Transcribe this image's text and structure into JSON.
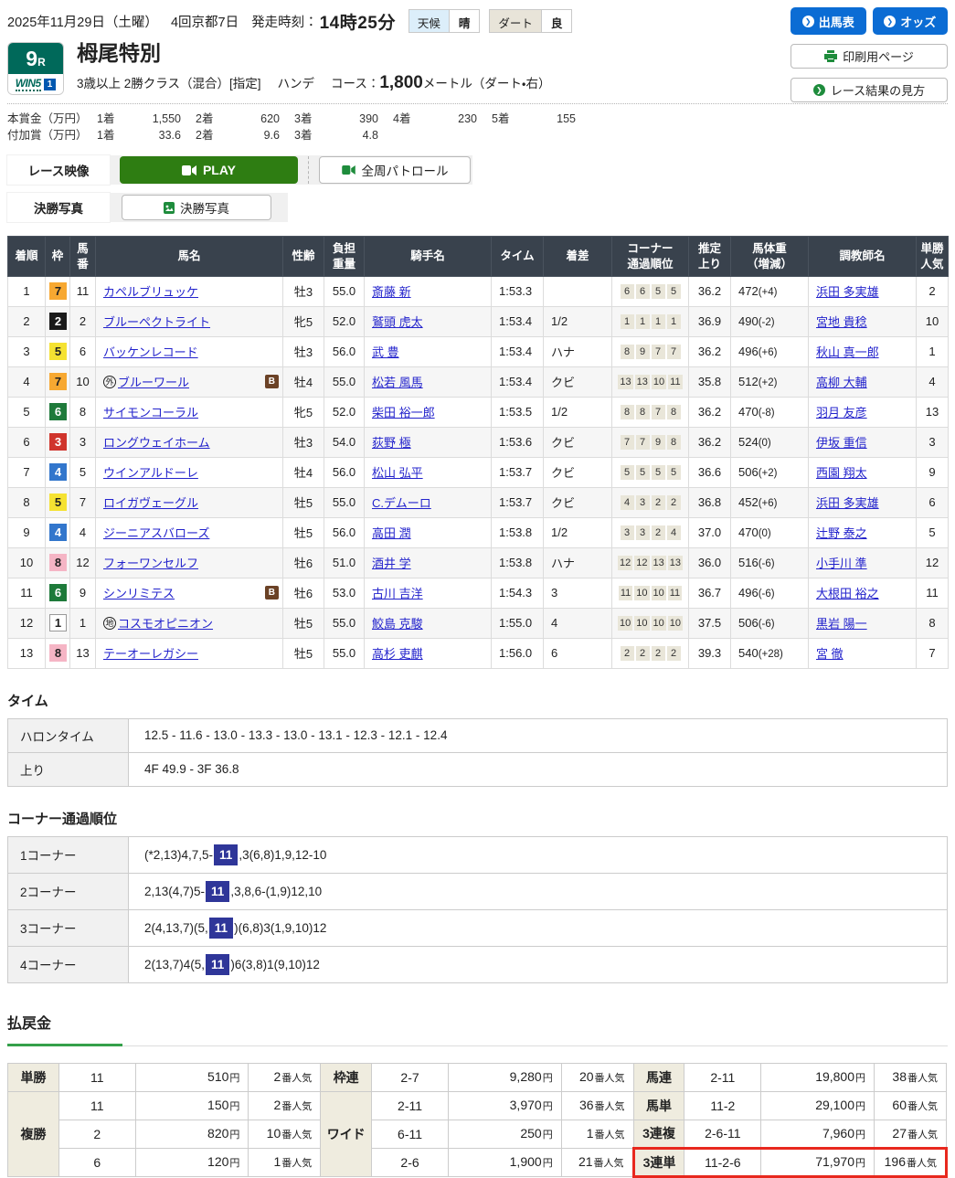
{
  "topbar": {
    "date": "2025年11月29日（土曜）",
    "meeting": "4回京都7日",
    "start_label": "発走時刻：",
    "start_time": "14時25分",
    "weather": {
      "label": "天候",
      "value": "晴"
    },
    "track": {
      "label": "ダート",
      "value": "良"
    }
  },
  "actions": {
    "entries": "出馬表",
    "odds": "オッズ",
    "print": "印刷用ページ",
    "guide": "レース結果の見方"
  },
  "race": {
    "number": "9",
    "r_suffix": "R",
    "win5": "WIN5",
    "win5_num": "1",
    "title": "栂尾特別",
    "cond": "3歳以上 2勝クラス（混合）[指定]",
    "handicap": "ハンデ",
    "course_label": "コース：",
    "distance": "1,800",
    "course_suffix": "メートル（ダート・右）"
  },
  "prizes": {
    "main": {
      "label": "本賞金（万円）",
      "items": [
        {
          "pos": "1着",
          "val": "1,550"
        },
        {
          "pos": "2着",
          "val": "620"
        },
        {
          "pos": "3着",
          "val": "390"
        },
        {
          "pos": "4着",
          "val": "230"
        },
        {
          "pos": "5着",
          "val": "155"
        }
      ]
    },
    "add": {
      "label": "付加賞（万円）",
      "items": [
        {
          "pos": "1着",
          "val": "33.6"
        },
        {
          "pos": "2着",
          "val": "9.6"
        },
        {
          "pos": "3着",
          "val": "4.8"
        }
      ]
    }
  },
  "media": {
    "video_label": "レース映像",
    "play": "PLAY",
    "patrol": "全周パトロール",
    "photo_label": "決勝写真",
    "photo_btn": "決勝写真"
  },
  "results": {
    "headers": [
      "着順",
      "枠",
      "馬\n番",
      "馬名",
      "性齢",
      "負担\n重量",
      "騎手名",
      "タイム",
      "着差",
      "コーナー\n通過順位",
      "推定\n上り",
      "馬体重\n（増減）",
      "調教師名",
      "単勝\n人気"
    ],
    "rows": [
      {
        "finish": "1",
        "frame": "7",
        "num": "11",
        "name": "カペルブリュッケ",
        "sex_age": "牡3",
        "weight": "55.0",
        "jockey": "斎藤 新",
        "time": "1:53.3",
        "margin": "",
        "corners": [
          "6",
          "6",
          "5",
          "5"
        ],
        "last3f": "36.2",
        "horse_weight": "472",
        "weight_diff": "(+4)",
        "trainer": "浜田 多実雄",
        "fav": "2"
      },
      {
        "finish": "2",
        "frame": "2",
        "num": "2",
        "name": "ブルーペクトライト",
        "sex_age": "牝5",
        "weight": "52.0",
        "jockey": "鷲頭 虎太",
        "time": "1:53.4",
        "margin": "1/2",
        "corners": [
          "1",
          "1",
          "1",
          "1"
        ],
        "last3f": "36.9",
        "horse_weight": "490",
        "weight_diff": "(-2)",
        "trainer": "宮地 貴稔",
        "fav": "10"
      },
      {
        "finish": "3",
        "frame": "5",
        "num": "6",
        "name": "バッケンレコード",
        "sex_age": "牡3",
        "weight": "56.0",
        "jockey": "武 豊",
        "time": "1:53.4",
        "margin": "ハナ",
        "corners": [
          "8",
          "9",
          "7",
          "7"
        ],
        "last3f": "36.2",
        "horse_weight": "496",
        "weight_diff": "(+6)",
        "trainer": "秋山 真一郎",
        "fav": "1"
      },
      {
        "finish": "4",
        "frame": "7",
        "num": "10",
        "mark": "外",
        "name": "ブルーワール",
        "b_badge": "B",
        "sex_age": "牡4",
        "weight": "55.0",
        "jockey": "松若 風馬",
        "time": "1:53.4",
        "margin": "クビ",
        "corners": [
          "13",
          "13",
          "10",
          "11"
        ],
        "last3f": "35.8",
        "horse_weight": "512",
        "weight_diff": "(+2)",
        "trainer": "高柳 大輔",
        "fav": "4"
      },
      {
        "finish": "5",
        "frame": "6",
        "num": "8",
        "name": "サイモンコーラル",
        "sex_age": "牝5",
        "weight": "52.0",
        "jockey": "柴田 裕一郎",
        "time": "1:53.5",
        "margin": "1/2",
        "corners": [
          "8",
          "8",
          "7",
          "8"
        ],
        "last3f": "36.2",
        "horse_weight": "470",
        "weight_diff": "(-8)",
        "trainer": "羽月 友彦",
        "fav": "13"
      },
      {
        "finish": "6",
        "frame": "3",
        "num": "3",
        "name": "ロングウェイホーム",
        "sex_age": "牡3",
        "weight": "54.0",
        "jockey": "荻野 極",
        "time": "1:53.6",
        "margin": "クビ",
        "corners": [
          "7",
          "7",
          "9",
          "8"
        ],
        "last3f": "36.2",
        "horse_weight": "524",
        "weight_diff": "(0)",
        "trainer": "伊坂 重信",
        "fav": "3"
      },
      {
        "finish": "7",
        "frame": "4",
        "num": "5",
        "name": "ウインアルドーレ",
        "sex_age": "牡4",
        "weight": "56.0",
        "jockey": "松山 弘平",
        "time": "1:53.7",
        "margin": "クビ",
        "corners": [
          "5",
          "5",
          "5",
          "5"
        ],
        "last3f": "36.6",
        "horse_weight": "506",
        "weight_diff": "(+2)",
        "trainer": "西園 翔太",
        "fav": "9"
      },
      {
        "finish": "8",
        "frame": "5",
        "num": "7",
        "name": "ロイガヴェーグル",
        "sex_age": "牡5",
        "weight": "55.0",
        "jockey": "C.デムーロ",
        "time": "1:53.7",
        "margin": "クビ",
        "corners": [
          "4",
          "3",
          "2",
          "2"
        ],
        "last3f": "36.8",
        "horse_weight": "452",
        "weight_diff": "(+6)",
        "trainer": "浜田 多実雄",
        "fav": "6"
      },
      {
        "finish": "9",
        "frame": "4",
        "num": "4",
        "name": "ジーニアスバローズ",
        "sex_age": "牡5",
        "weight": "56.0",
        "jockey": "高田 潤",
        "time": "1:53.8",
        "margin": "1/2",
        "corners": [
          "3",
          "3",
          "2",
          "4"
        ],
        "last3f": "37.0",
        "horse_weight": "470",
        "weight_diff": "(0)",
        "trainer": "辻野 泰之",
        "fav": "5"
      },
      {
        "finish": "10",
        "frame": "8",
        "num": "12",
        "name": "フォーワンセルフ",
        "sex_age": "牡6",
        "weight": "51.0",
        "jockey": "酒井 学",
        "time": "1:53.8",
        "margin": "ハナ",
        "corners": [
          "12",
          "12",
          "13",
          "13"
        ],
        "last3f": "36.0",
        "horse_weight": "516",
        "weight_diff": "(-6)",
        "trainer": "小手川 準",
        "fav": "12"
      },
      {
        "finish": "11",
        "frame": "6",
        "num": "9",
        "name": "シンリミテス",
        "b_badge": "B",
        "sex_age": "牡6",
        "weight": "53.0",
        "jockey": "古川 吉洋",
        "time": "1:54.3",
        "margin": "3",
        "corners": [
          "11",
          "10",
          "10",
          "11"
        ],
        "last3f": "36.7",
        "horse_weight": "496",
        "weight_diff": "(-6)",
        "trainer": "大根田 裕之",
        "fav": "11"
      },
      {
        "finish": "12",
        "frame": "1",
        "num": "1",
        "mark": "地",
        "name": "コスモオピニオン",
        "sex_age": "牡5",
        "weight": "55.0",
        "jockey": "鮫島 克駿",
        "time": "1:55.0",
        "margin": "4",
        "corners": [
          "10",
          "10",
          "10",
          "10"
        ],
        "last3f": "37.5",
        "horse_weight": "506",
        "weight_diff": "(-6)",
        "trainer": "黒岩 陽一",
        "fav": "8"
      },
      {
        "finish": "13",
        "frame": "8",
        "num": "13",
        "name": "テーオーレガシー",
        "sex_age": "牡5",
        "weight": "55.0",
        "jockey": "高杉 吏麒",
        "time": "1:56.0",
        "margin": "6",
        "corners": [
          "2",
          "2",
          "2",
          "2"
        ],
        "last3f": "39.3",
        "horse_weight": "540",
        "weight_diff": "(+28)",
        "trainer": "宮 徹",
        "fav": "7"
      }
    ]
  },
  "time": {
    "title": "タイム",
    "rows": [
      {
        "label": "ハロンタイム",
        "value": "12.5 - 11.6 - 13.0 - 13.3 - 13.0 - 13.1 - 12.3 - 12.1 - 12.4"
      },
      {
        "label": "上り",
        "value": "4F 49.9 - 3F 36.8"
      }
    ]
  },
  "corners": {
    "title": "コーナー通過順位",
    "rows": [
      {
        "label": "1コーナー",
        "pre": "(*2,13)4,7,5-",
        "hl": "11",
        "post": ",3(6,8)1,9,12-10"
      },
      {
        "label": "2コーナー",
        "pre": "2,13(4,7)5-",
        "hl": "11",
        "post": ",3,8,6-(1,9)12,10"
      },
      {
        "label": "3コーナー",
        "pre": "2(4,13,7)(5,",
        "hl": "11",
        "post": ")(6,8)3(1,9,10)12"
      },
      {
        "label": "4コーナー",
        "pre": "2(13,7)4(5,",
        "hl": "11",
        "post": ")6(3,8)1(9,10)12"
      }
    ]
  },
  "payouts": {
    "title": "払戻金",
    "unit_yen": "円",
    "unit_fav": "番人気",
    "groups": [
      {
        "rows": [
          {
            "type": "単勝",
            "span": 1,
            "comb": "11",
            "amount": "510",
            "fav": "2"
          },
          {
            "type": "複勝",
            "span": 3,
            "comb": "11",
            "amount": "150",
            "fav": "2"
          },
          {
            "comb": "2",
            "amount": "820",
            "fav": "10",
            "inner": true
          },
          {
            "comb": "6",
            "amount": "120",
            "fav": "1",
            "inner": true
          }
        ]
      },
      {
        "rows": [
          {
            "type": "枠連",
            "span": 1,
            "comb": "2-7",
            "amount": "9,280",
            "fav": "20"
          },
          {
            "type": "ワイド",
            "span": 3,
            "comb": "2-11",
            "amount": "3,970",
            "fav": "36"
          },
          {
            "comb": "6-11",
            "amount": "250",
            "fav": "1",
            "inner": true
          },
          {
            "comb": "2-6",
            "amount": "1,900",
            "fav": "21",
            "inner": true
          }
        ]
      },
      {
        "rows": [
          {
            "type": "馬連",
            "span": 1,
            "comb": "2-11",
            "amount": "19,800",
            "fav": "38"
          },
          {
            "type": "馬単",
            "span": 1,
            "comb": "11-2",
            "amount": "29,100",
            "fav": "60"
          },
          {
            "type": "3連複",
            "span": 1,
            "comb": "2-6-11",
            "amount": "7,960",
            "fav": "27"
          },
          {
            "type": "3連単",
            "span": 1,
            "comb": "11-2-6",
            "amount": "71,970",
            "fav": "196",
            "highlight": true
          }
        ]
      }
    ]
  },
  "colors": {
    "accent_blue": "#0b6cd4",
    "play_green": "#2e7d12",
    "table_header": "#39424d",
    "link_blue": "#2323cc",
    "race_badge_green": "#00695a",
    "red_highlight": "#e8281e",
    "corner_highlight": "#2f3699",
    "frames": {
      "1": {
        "bg": "#ffffff",
        "fg": "#222222",
        "border": "#999999"
      },
      "2": {
        "bg": "#1a1a1a",
        "fg": "#ffffff"
      },
      "3": {
        "bg": "#d0342c",
        "fg": "#ffffff"
      },
      "4": {
        "bg": "#3276cc",
        "fg": "#ffffff"
      },
      "5": {
        "bg": "#f5e232",
        "fg": "#222222"
      },
      "6": {
        "bg": "#1e7a3a",
        "fg": "#ffffff"
      },
      "7": {
        "bg": "#f7a831",
        "fg": "#222222"
      },
      "8": {
        "bg": "#f5b5c5",
        "fg": "#222222"
      }
    }
  }
}
